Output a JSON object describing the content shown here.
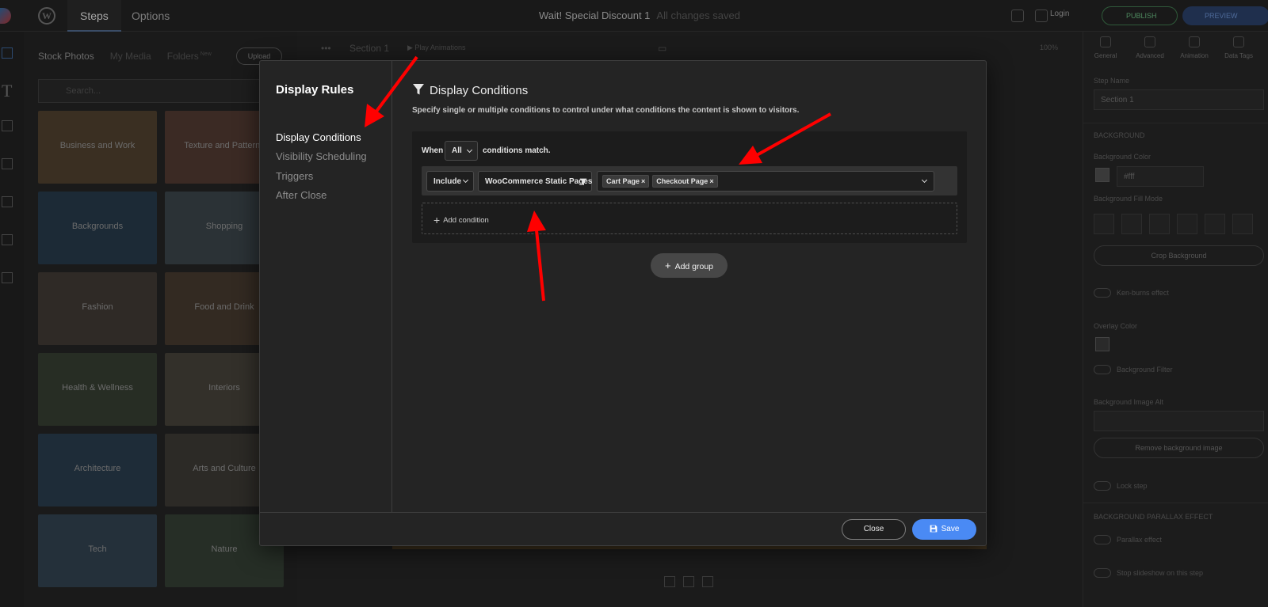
{
  "topbar": {
    "tabs": [
      "Steps",
      "Options"
    ],
    "title": "Wait! Special Discount 1",
    "title_sub": "All changes saved",
    "login_label": "Login",
    "publish_label": "PUBLISH",
    "preview_label": "PREVIEW"
  },
  "media": {
    "tabs": [
      "Stock Photos",
      "My Media",
      "Folders"
    ],
    "new_badge": "New",
    "upload_label": "Upload",
    "search_placeholder": "Search...",
    "categories": [
      "Business and Work",
      "Texture and Patterns",
      "Backgrounds",
      "Shopping",
      "Fashion",
      "Food and Drink",
      "Health & Wellness",
      "Interiors",
      "Architecture",
      "Arts and Culture",
      "Tech",
      "Nature"
    ]
  },
  "canvas": {
    "section_label": "Section 1",
    "play_label": "Play Animations",
    "zoom": "100%"
  },
  "right_panel": {
    "tabs": [
      "General",
      "Advanced",
      "Animation",
      "Data Tags"
    ],
    "step_name_label": "Step Name",
    "step_name_value": "Section 1",
    "section_heading": "BACKGROUND",
    "bg_color_label": "Background Color",
    "bg_color_value": "#fff",
    "fill_mode_label": "Background Fill Mode",
    "crop_label": "Crop Background",
    "ken_burns_label": "Ken-burns effect",
    "overlay_label": "Overlay Color",
    "bg_filter_label": "Background Filter",
    "img_alt_label": "Background Image Alt",
    "remove_bg_label": "Remove background image",
    "lock_label": "Lock step",
    "parallax_heading": "BACKGROUND PARALLAX EFFECT",
    "parallax_label": "Parallax effect",
    "slideshow_label": "Stop slideshow on this step"
  },
  "modal": {
    "title": "Display Rules",
    "nav": [
      "Display Conditions",
      "Visibility Scheduling",
      "Triggers",
      "After Close"
    ],
    "active_nav": 0,
    "content_title": "Display Conditions",
    "description": "Specify single or multiple conditions to control under what conditions the content is shown to visitors.",
    "when_label": "When",
    "match_select": "All",
    "match_suffix": "conditions match.",
    "condition": {
      "mode": "Include",
      "type": "WooCommerce Static Pages",
      "tags": [
        "Cart Page",
        "Checkout Page"
      ],
      "tag_remove": "×"
    },
    "add_condition_label": "Add condition",
    "add_group_label": "Add group",
    "close_label": "Close",
    "save_label": "Save"
  },
  "colors": {
    "accent_blue": "#4a8af4",
    "annotation_red": "#ff0000"
  }
}
